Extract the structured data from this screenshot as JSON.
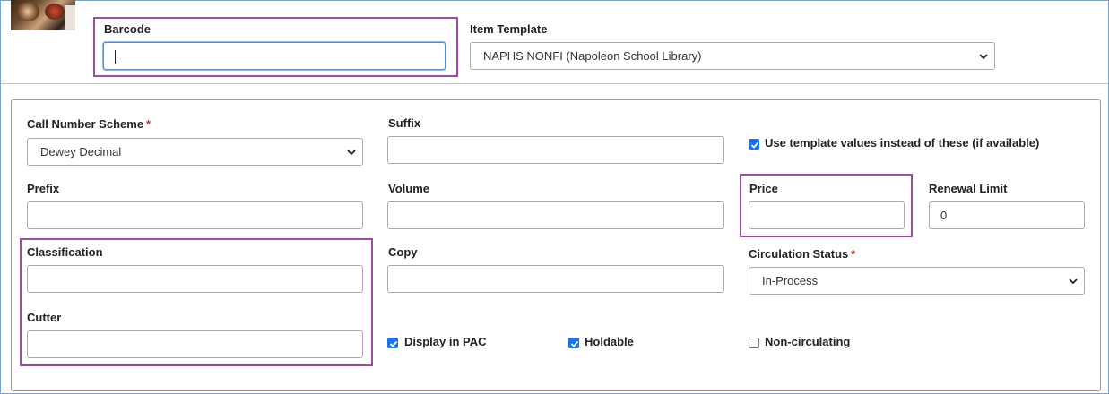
{
  "header": {
    "barcode_label": "Barcode",
    "barcode_value": "",
    "item_template_label": "Item Template",
    "item_template_value": "NAPHS NONFI (Napoleon School Library)"
  },
  "form": {
    "call_number_scheme": {
      "label": "Call Number Scheme",
      "required": "*",
      "value": "Dewey Decimal"
    },
    "suffix": {
      "label": "Suffix",
      "value": ""
    },
    "use_template": {
      "label": "Use template values instead of these (if available)",
      "checked": true
    },
    "prefix": {
      "label": "Prefix",
      "value": ""
    },
    "volume": {
      "label": "Volume",
      "value": ""
    },
    "price": {
      "label": "Price",
      "value": ""
    },
    "renewal_limit": {
      "label": "Renewal Limit",
      "value": "0"
    },
    "classification": {
      "label": "Classification",
      "value": ""
    },
    "copy": {
      "label": "Copy",
      "value": ""
    },
    "circulation_status": {
      "label": "Circulation Status",
      "required": "*",
      "value": "In-Process"
    },
    "cutter": {
      "label": "Cutter",
      "value": ""
    },
    "display_in_pac": {
      "label": "Display in PAC",
      "checked": true
    },
    "holdable": {
      "label": "Holdable",
      "checked": true
    },
    "non_circulating": {
      "label": "Non-circulating",
      "checked": false
    }
  },
  "colors": {
    "highlight": "#9b4f9e",
    "checkbox": "#1a73e8",
    "required": "#c0392b",
    "focus": "#4a90d9"
  },
  "icons": {
    "thumbnail": "food-thumbnail-image",
    "dropdown": "chevron-down-icon",
    "check": "checkmark-icon"
  }
}
